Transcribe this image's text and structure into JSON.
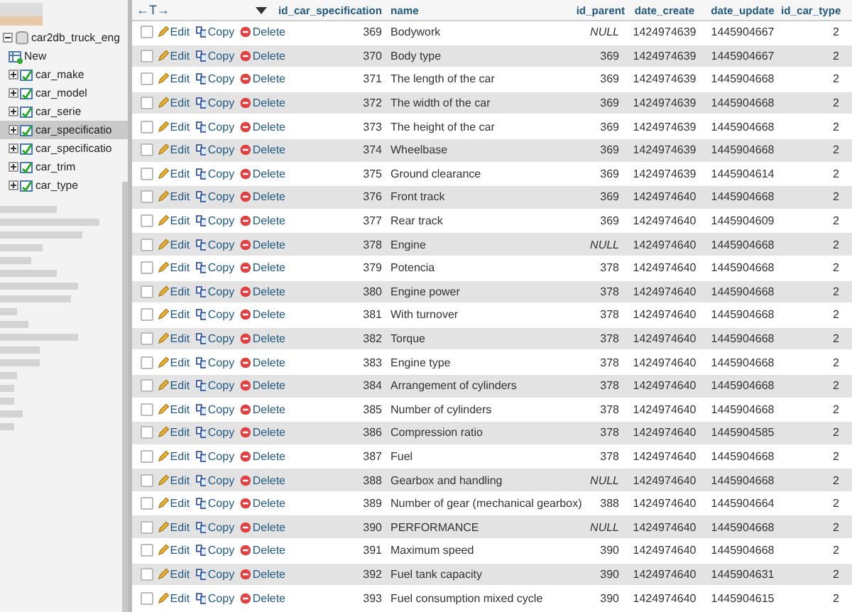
{
  "sidebar": {
    "tree": [
      {
        "label": "car2db_truck_eng",
        "expanded": true,
        "children": [
          {
            "label": "New",
            "kind": "new"
          },
          {
            "label": "car_make",
            "kind": "table",
            "expanded": false,
            "selected": false
          },
          {
            "label": "car_model",
            "kind": "table",
            "expanded": false,
            "selected": false
          },
          {
            "label": "car_serie",
            "kind": "table",
            "expanded": false,
            "selected": false
          },
          {
            "label": "car_specificatio",
            "kind": "table",
            "expanded": false,
            "selected": true
          },
          {
            "label": "car_specificatio",
            "kind": "table",
            "expanded": false,
            "selected": false
          },
          {
            "label": "car_trim",
            "kind": "table",
            "expanded": false,
            "selected": false
          },
          {
            "label": "car_type",
            "kind": "table",
            "expanded": false,
            "selected": false
          }
        ]
      }
    ]
  },
  "table": {
    "nav_label": "←T→",
    "columns": [
      "id_car_specification",
      "name",
      "id_parent",
      "date_create",
      "date_update",
      "id_car_type"
    ],
    "rows": [
      {
        "checked": false,
        "actions": [
          "Edit",
          "Copy",
          "Delete"
        ],
        "id": "369",
        "name": "Bodywork",
        "parent": "NULL",
        "parent_null": true,
        "date_create": "1424974639",
        "date_update": "1445904667",
        "type": "2"
      },
      {
        "checked": false,
        "actions": [
          "Edit",
          "Copy",
          "Delete"
        ],
        "id": "370",
        "name": "Body type",
        "parent": "369",
        "parent_null": false,
        "date_create": "1424974639",
        "date_update": "1445904667",
        "type": "2"
      },
      {
        "checked": false,
        "actions": [
          "Edit",
          "Copy",
          "Delete"
        ],
        "id": "371",
        "name": "The length of the car",
        "parent": "369",
        "parent_null": false,
        "date_create": "1424974639",
        "date_update": "1445904668",
        "type": "2"
      },
      {
        "checked": false,
        "actions": [
          "Edit",
          "Copy",
          "Delete"
        ],
        "id": "372",
        "name": "The width of the car",
        "parent": "369",
        "parent_null": false,
        "date_create": "1424974639",
        "date_update": "1445904668",
        "type": "2"
      },
      {
        "checked": false,
        "actions": [
          "Edit",
          "Copy",
          "Delete"
        ],
        "id": "373",
        "name": "The height of the car",
        "parent": "369",
        "parent_null": false,
        "date_create": "1424974639",
        "date_update": "1445904668",
        "type": "2"
      },
      {
        "checked": false,
        "actions": [
          "Edit",
          "Copy",
          "Delete"
        ],
        "id": "374",
        "name": "Wheelbase",
        "parent": "369",
        "parent_null": false,
        "date_create": "1424974639",
        "date_update": "1445904668",
        "type": "2"
      },
      {
        "checked": false,
        "actions": [
          "Edit",
          "Copy",
          "Delete"
        ],
        "id": "375",
        "name": "Ground clearance",
        "parent": "369",
        "parent_null": false,
        "date_create": "1424974639",
        "date_update": "1445904614",
        "type": "2"
      },
      {
        "checked": false,
        "actions": [
          "Edit",
          "Copy",
          "Delete"
        ],
        "id": "376",
        "name": "Front track",
        "parent": "369",
        "parent_null": false,
        "date_create": "1424974640",
        "date_update": "1445904668",
        "type": "2"
      },
      {
        "checked": false,
        "actions": [
          "Edit",
          "Copy",
          "Delete"
        ],
        "id": "377",
        "name": "Rear track",
        "parent": "369",
        "parent_null": false,
        "date_create": "1424974640",
        "date_update": "1445904609",
        "type": "2"
      },
      {
        "checked": false,
        "actions": [
          "Edit",
          "Copy",
          "Delete"
        ],
        "id": "378",
        "name": "Engine",
        "parent": "NULL",
        "parent_null": true,
        "date_create": "1424974640",
        "date_update": "1445904668",
        "type": "2"
      },
      {
        "checked": false,
        "actions": [
          "Edit",
          "Copy",
          "Delete"
        ],
        "id": "379",
        "name": "Potencia",
        "parent": "378",
        "parent_null": false,
        "date_create": "1424974640",
        "date_update": "1445904668",
        "type": "2"
      },
      {
        "checked": false,
        "actions": [
          "Edit",
          "Copy",
          "Delete"
        ],
        "id": "380",
        "name": "Engine power",
        "parent": "378",
        "parent_null": false,
        "date_create": "1424974640",
        "date_update": "1445904668",
        "type": "2"
      },
      {
        "checked": false,
        "actions": [
          "Edit",
          "Copy",
          "Delete"
        ],
        "id": "381",
        "name": "With turnover",
        "parent": "378",
        "parent_null": false,
        "date_create": "1424974640",
        "date_update": "1445904668",
        "type": "2"
      },
      {
        "checked": false,
        "actions": [
          "Edit",
          "Copy",
          "Delete"
        ],
        "id": "382",
        "name": "Torque",
        "parent": "378",
        "parent_null": false,
        "date_create": "1424974640",
        "date_update": "1445904668",
        "type": "2"
      },
      {
        "checked": false,
        "actions": [
          "Edit",
          "Copy",
          "Delete"
        ],
        "id": "383",
        "name": "Engine type",
        "parent": "378",
        "parent_null": false,
        "date_create": "1424974640",
        "date_update": "1445904668",
        "type": "2"
      },
      {
        "checked": false,
        "actions": [
          "Edit",
          "Copy",
          "Delete"
        ],
        "id": "384",
        "name": "Arrangement of cylinders",
        "parent": "378",
        "parent_null": false,
        "date_create": "1424974640",
        "date_update": "1445904668",
        "type": "2"
      },
      {
        "checked": false,
        "actions": [
          "Edit",
          "Copy",
          "Delete"
        ],
        "id": "385",
        "name": "Number of cylinders",
        "parent": "378",
        "parent_null": false,
        "date_create": "1424974640",
        "date_update": "1445904668",
        "type": "2"
      },
      {
        "checked": false,
        "actions": [
          "Edit",
          "Copy",
          "Delete"
        ],
        "id": "386",
        "name": "Compression ratio",
        "parent": "378",
        "parent_null": false,
        "date_create": "1424974640",
        "date_update": "1445904585",
        "type": "2"
      },
      {
        "checked": false,
        "actions": [
          "Edit",
          "Copy",
          "Delete"
        ],
        "id": "387",
        "name": "Fuel",
        "parent": "378",
        "parent_null": false,
        "date_create": "1424974640",
        "date_update": "1445904668",
        "type": "2"
      },
      {
        "checked": false,
        "actions": [
          "Edit",
          "Copy",
          "Delete"
        ],
        "id": "388",
        "name": "Gearbox and handling",
        "parent": "NULL",
        "parent_null": true,
        "date_create": "1424974640",
        "date_update": "1445904668",
        "type": "2"
      },
      {
        "checked": false,
        "actions": [
          "Edit",
          "Copy",
          "Delete"
        ],
        "id": "389",
        "name": "Number of gear (mechanical gearbox)",
        "parent": "388",
        "parent_null": false,
        "date_create": "1424974640",
        "date_update": "1445904664",
        "type": "2"
      },
      {
        "checked": false,
        "actions": [
          "Edit",
          "Copy",
          "Delete"
        ],
        "id": "390",
        "name": "PERFORMANCE",
        "parent": "NULL",
        "parent_null": true,
        "date_create": "1424974640",
        "date_update": "1445904668",
        "type": "2"
      },
      {
        "checked": false,
        "actions": [
          "Edit",
          "Copy",
          "Delete"
        ],
        "id": "391",
        "name": "Maximum speed",
        "parent": "390",
        "parent_null": false,
        "date_create": "1424974640",
        "date_update": "1445904668",
        "type": "2"
      },
      {
        "checked": false,
        "actions": [
          "Edit",
          "Copy",
          "Delete"
        ],
        "id": "392",
        "name": "Fuel tank capacity",
        "parent": "390",
        "parent_null": false,
        "date_create": "1424974640",
        "date_update": "1445904631",
        "type": "2"
      },
      {
        "checked": false,
        "actions": [
          "Edit",
          "Copy",
          "Delete"
        ],
        "id": "393",
        "name": "Fuel consumption mixed cycle",
        "parent": "390",
        "parent_null": false,
        "date_create": "1424974640",
        "date_update": "1445904615",
        "type": "2"
      }
    ]
  }
}
